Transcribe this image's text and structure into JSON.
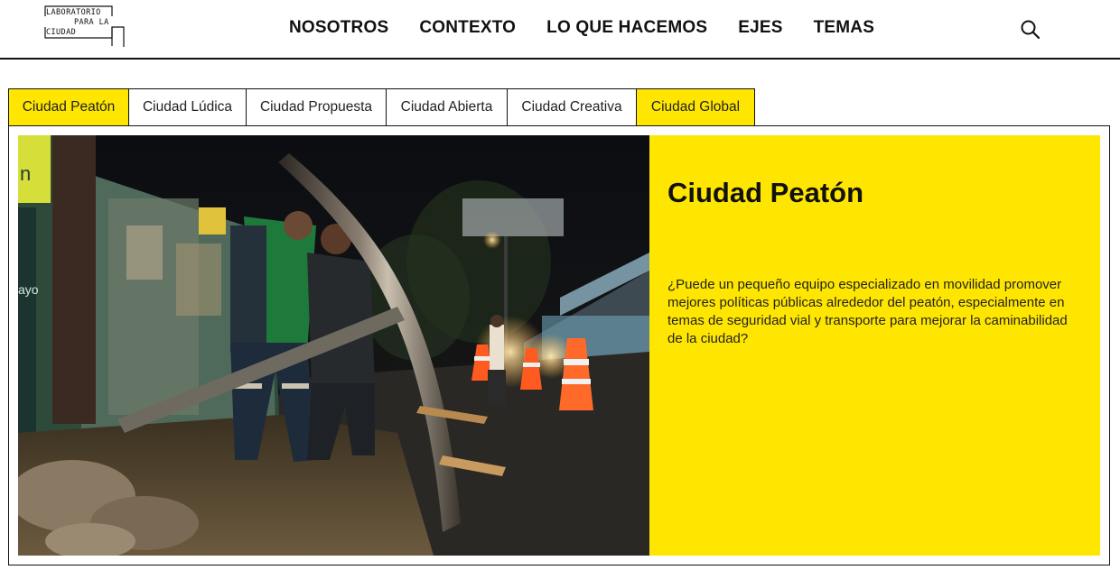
{
  "logo": {
    "line1": "LABORATORIO",
    "line2": "PARA LA",
    "line3": "CIUDAD"
  },
  "nav": {
    "items": [
      {
        "label": "NOSOTROS"
      },
      {
        "label": "CONTEXTO"
      },
      {
        "label": "LO QUE HACEMOS"
      },
      {
        "label": "EJES"
      },
      {
        "label": "TEMAS"
      }
    ],
    "search_icon": "search-icon"
  },
  "tabs": [
    {
      "label": "Ciudad Peatón",
      "active": true
    },
    {
      "label": "Ciudad Lúdica",
      "active": false
    },
    {
      "label": "Ciudad Propuesta",
      "active": false
    },
    {
      "label": "Ciudad Abierta",
      "active": false
    },
    {
      "label": "Ciudad Creativa",
      "active": false
    },
    {
      "label": "Ciudad Global",
      "active": true
    }
  ],
  "panel": {
    "title": "Ciudad Peatón",
    "description": "¿Puede un pequeño equipo especializado en movilidad promover mejores políticas públicas alrededor del peatón, especialmente en temas de seguridad vial y transporte para mejorar la caminabilidad de la ciudad?",
    "photo_sign_left": "n",
    "photo_sign_left2": "ayo"
  },
  "colors": {
    "accent": "#ffe600",
    "text": "#111111",
    "border": "#111111"
  }
}
